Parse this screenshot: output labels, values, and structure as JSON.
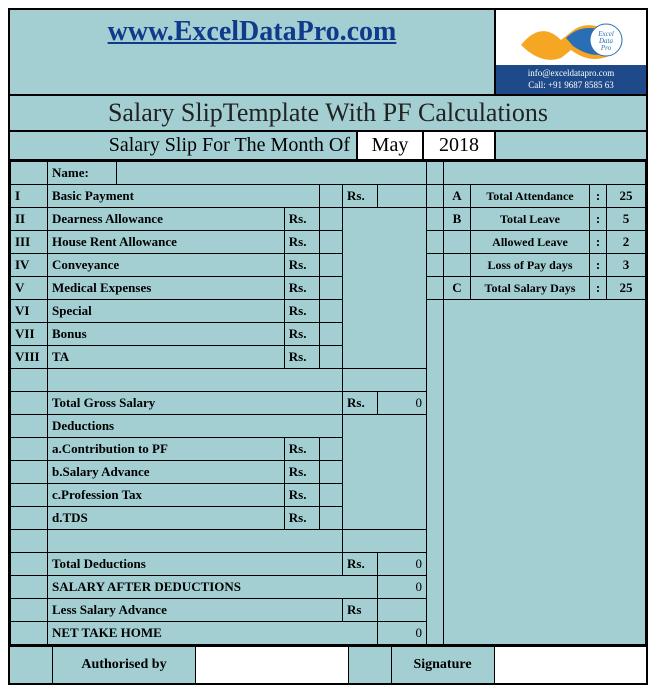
{
  "header": {
    "url": "www.ExcelDataPro.com",
    "title": "Salary SlipTemplate With PF Calculations",
    "month_label": "Salary Slip For The Month Of",
    "month": "May",
    "year": "2018",
    "contact_email": "info@exceldatapro.com",
    "contact_phone": "Call: +91 9687 8585 63",
    "logo_text1": "Excel",
    "logo_text2": "Data",
    "logo_text3": "Pro"
  },
  "name_label": "Name:",
  "rows": {
    "r1": {
      "rn": "I",
      "label": "Basic Payment",
      "rs": "Rs."
    },
    "r2": {
      "rn": "II",
      "label": "Dearness Allowance",
      "rs": "Rs."
    },
    "r3": {
      "rn": "III",
      "label": "House Rent Allowance",
      "rs": "Rs."
    },
    "r4": {
      "rn": "IV",
      "label": "Conveyance",
      "rs": "Rs."
    },
    "r5": {
      "rn": "V",
      "label": "Medical Expenses",
      "rs": "Rs."
    },
    "r6": {
      "rn": "VI",
      "label": "Special",
      "rs": "Rs."
    },
    "r7": {
      "rn": "VII",
      "label": "Bonus",
      "rs": "Rs."
    },
    "r8": {
      "rn": "VIII",
      "label": "TA",
      "rs": "Rs."
    }
  },
  "gross": {
    "label": "Total Gross Salary",
    "rs": "Rs.",
    "val": "0"
  },
  "deductions_header": "Deductions",
  "ded": {
    "a": {
      "label": "a.Contribution to PF",
      "rs": "Rs."
    },
    "b": {
      "label": "b.Salary Advance",
      "rs": "Rs."
    },
    "c": {
      "label": "c.Profession Tax",
      "rs": "Rs."
    },
    "d": {
      "label": "d.TDS",
      "rs": "Rs."
    }
  },
  "total_ded": {
    "label": "Total Deductions",
    "rs": "Rs.",
    "val": "0"
  },
  "after_ded": {
    "label": "SALARY AFTER DEDUCTIONS",
    "val": "0"
  },
  "less_adv": {
    "label": "Less Salary Advance",
    "rs": "Rs"
  },
  "net": {
    "label": "NET TAKE HOME",
    "val": "0"
  },
  "attendance": {
    "a": {
      "key": "A",
      "label": "Total Attendance",
      "val": "25"
    },
    "b": {
      "key": "B",
      "label": "Total Leave",
      "val": "5"
    },
    "c": {
      "key": "",
      "label": "Allowed Leave",
      "val": "2"
    },
    "d": {
      "key": "",
      "label": "Loss of Pay days",
      "val": "3"
    },
    "e": {
      "key": "C",
      "label": "Total Salary Days",
      "val": "25"
    }
  },
  "footer": {
    "auth": "Authorised by",
    "sig": "Signature"
  },
  "colon": ":"
}
